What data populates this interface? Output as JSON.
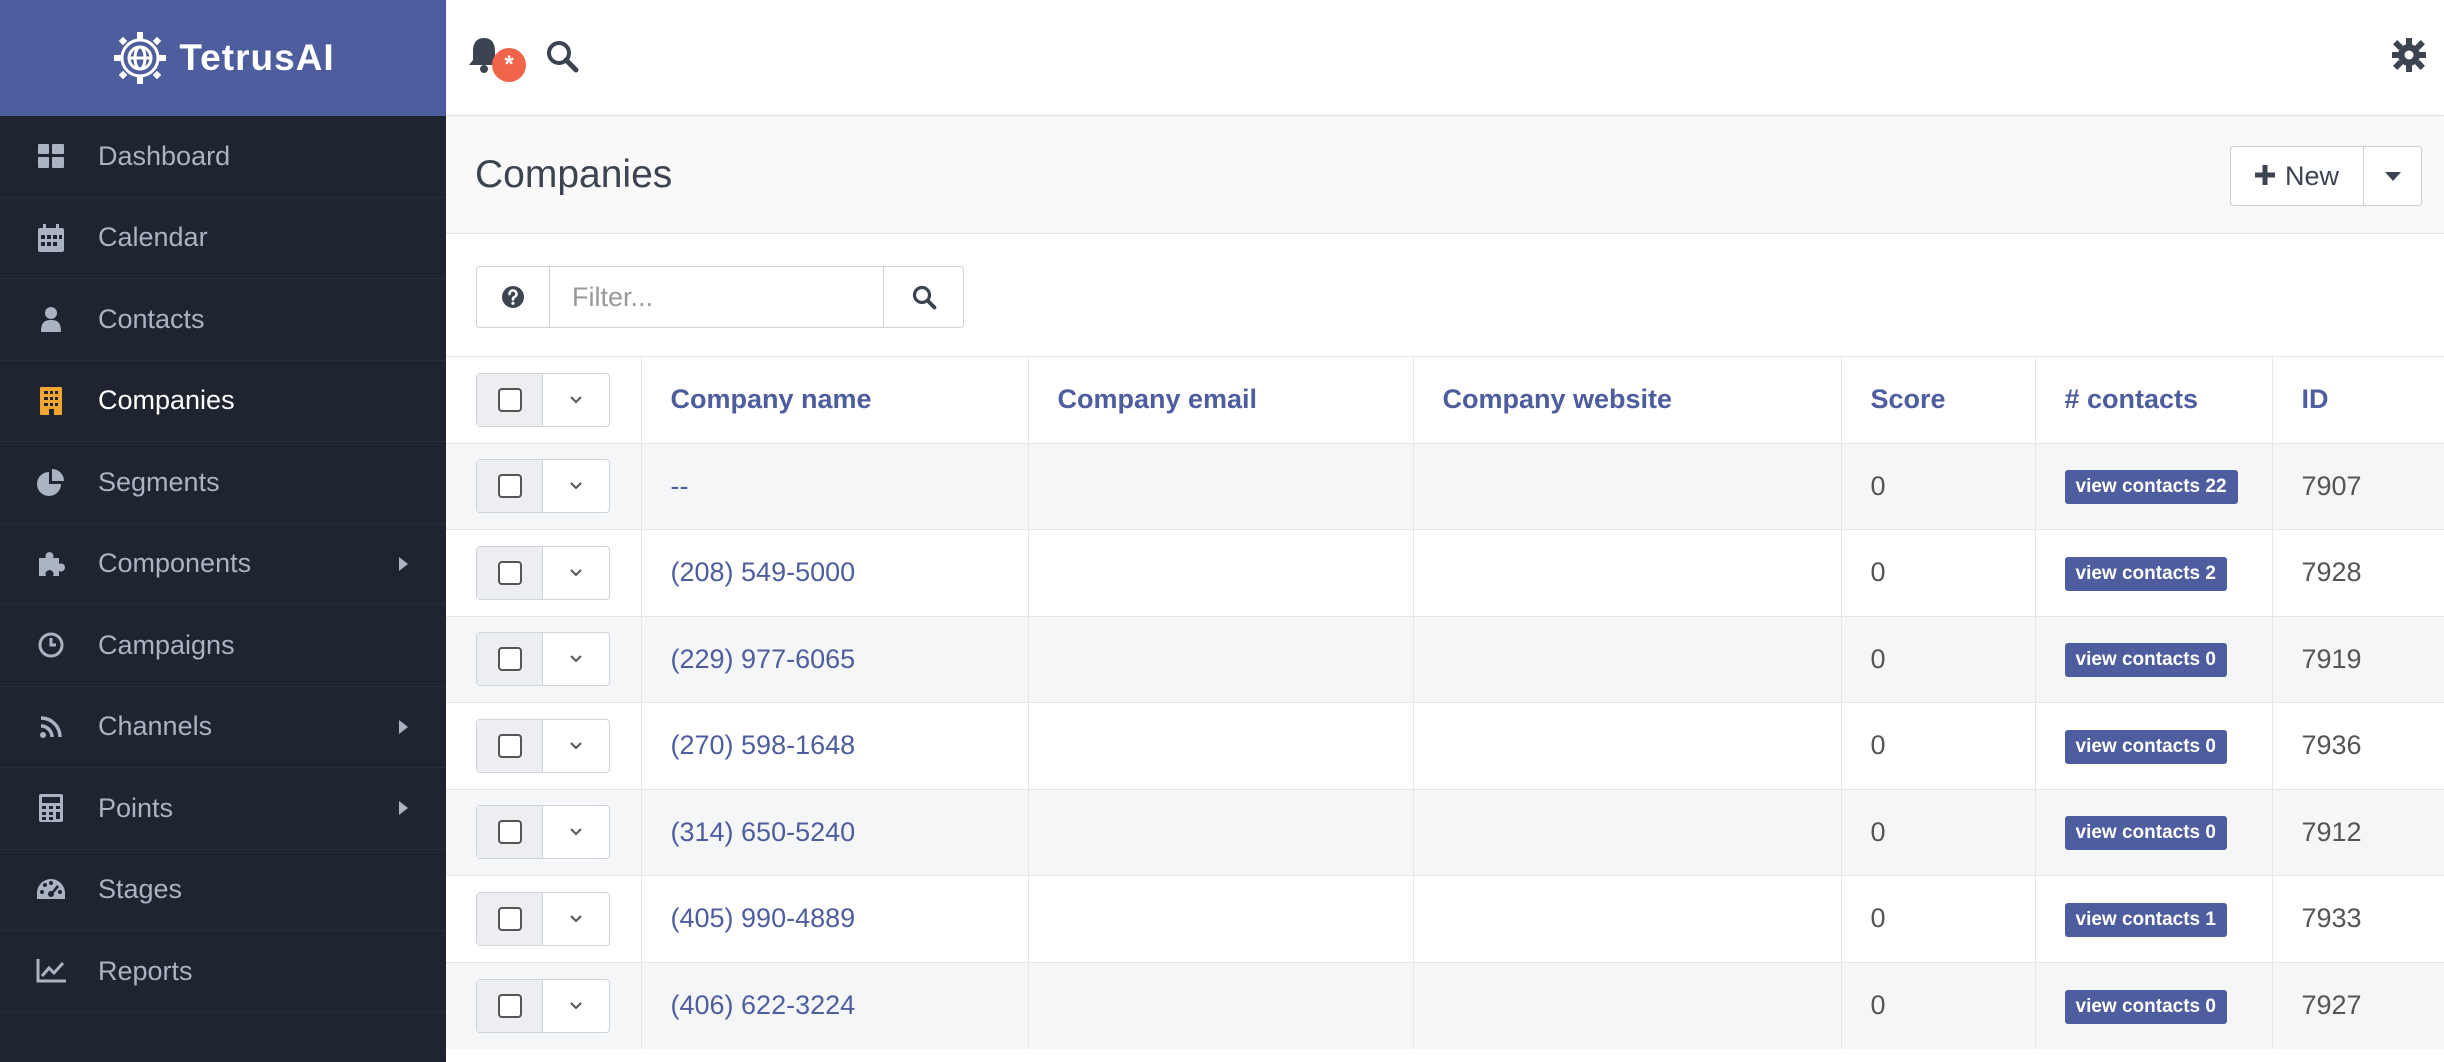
{
  "brand": {
    "name": "TetrusAI"
  },
  "sidebar": {
    "items": [
      {
        "label": "Dashboard",
        "icon": "dashboard-icon"
      },
      {
        "label": "Calendar",
        "icon": "calendar-icon"
      },
      {
        "label": "Contacts",
        "icon": "user-icon"
      },
      {
        "label": "Companies",
        "icon": "building-icon",
        "active": true
      },
      {
        "label": "Segments",
        "icon": "pie-chart-icon"
      },
      {
        "label": "Components",
        "icon": "puzzle-icon",
        "has_submenu": true
      },
      {
        "label": "Campaigns",
        "icon": "clock-icon"
      },
      {
        "label": "Channels",
        "icon": "rss-icon",
        "has_submenu": true
      },
      {
        "label": "Points",
        "icon": "calculator-icon",
        "has_submenu": true
      },
      {
        "label": "Stages",
        "icon": "tachometer-icon"
      },
      {
        "label": "Reports",
        "icon": "line-chart-icon"
      }
    ]
  },
  "topbar": {
    "notification_badge": "*"
  },
  "page": {
    "title": "Companies",
    "new_label": "New"
  },
  "filter": {
    "placeholder": "Filter..."
  },
  "table": {
    "columns": [
      "Company name",
      "Company email",
      "Company website",
      "Score",
      "# contacts",
      "ID"
    ],
    "rows": [
      {
        "name": "--",
        "email": "",
        "website": "",
        "score": "0",
        "contacts": "view contacts 22",
        "id": "7907"
      },
      {
        "name": "(208) 549-5000",
        "email": "",
        "website": "",
        "score": "0",
        "contacts": "view contacts 2",
        "id": "7928"
      },
      {
        "name": "(229) 977-6065",
        "email": "",
        "website": "",
        "score": "0",
        "contacts": "view contacts 0",
        "id": "7919"
      },
      {
        "name": "(270) 598-1648",
        "email": "",
        "website": "",
        "score": "0",
        "contacts": "view contacts 0",
        "id": "7936"
      },
      {
        "name": "(314) 650-5240",
        "email": "",
        "website": "",
        "score": "0",
        "contacts": "view contacts 0",
        "id": "7912"
      },
      {
        "name": "(405) 990-4889",
        "email": "",
        "website": "",
        "score": "0",
        "contacts": "view contacts 1",
        "id": "7933"
      },
      {
        "name": "(406) 622-3224",
        "email": "",
        "website": "",
        "score": "0",
        "contacts": "view contacts 0",
        "id": "7927"
      }
    ]
  },
  "colors": {
    "brand": "#4e5d9d",
    "sidebar_bg": "#1e2530",
    "active_icon": "#f0a630",
    "badge": "#f0644b"
  }
}
